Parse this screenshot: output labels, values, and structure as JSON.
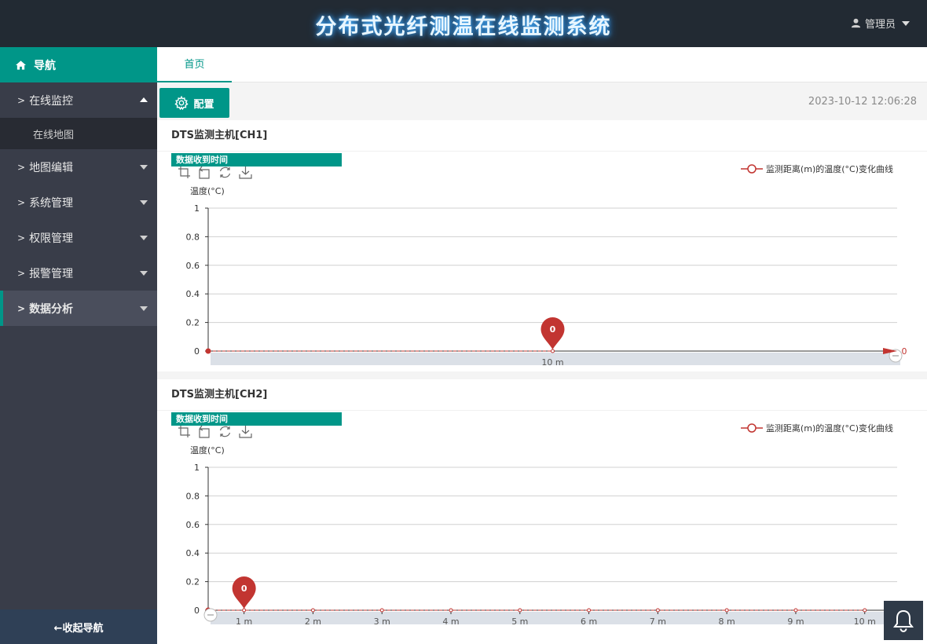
{
  "header": {
    "title": "分布式光纤测温在线监测系统",
    "user_label": "管理员"
  },
  "sidebar": {
    "nav_title": "导航",
    "items": [
      {
        "label": "在线监控",
        "state": "open",
        "sub": [
          "在线地图"
        ]
      },
      {
        "label": "地图编辑",
        "state": "collapsed"
      },
      {
        "label": "系统管理",
        "state": "collapsed"
      },
      {
        "label": "权限管理",
        "state": "collapsed"
      },
      {
        "label": "报警管理",
        "state": "collapsed"
      },
      {
        "label": "数据分析",
        "state": "active"
      }
    ],
    "collapse_label": "←收起导航"
  },
  "tabs": [
    {
      "label": "首页"
    }
  ],
  "toolbar": {
    "config_label": "配置",
    "datetime": "2023-10-12 12:06:28"
  },
  "panels": [
    {
      "title": "DTS监测主机[CH1]",
      "badge": "数据收到时间",
      "legend": "监测距离(m)的温度(°C)变化曲线",
      "ylabel": "温度(°C)",
      "yticks": [
        "1",
        "0.8",
        "0.6",
        "0.4",
        "0.2",
        "0"
      ],
      "xticks": [
        "10 m"
      ],
      "marker_value": "0",
      "end_value": "0"
    },
    {
      "title": "DTS监测主机[CH2]",
      "badge": "数据收到时间",
      "legend": "监测距离(m)的温度(°C)变化曲线",
      "ylabel": "温度(°C)",
      "yticks": [
        "1",
        "0.8",
        "0.6",
        "0.4",
        "0.2",
        "0"
      ],
      "xticks": [
        "1 m",
        "2 m",
        "3 m",
        "4 m",
        "5 m",
        "6 m",
        "7 m",
        "8 m",
        "9 m",
        "10 m"
      ],
      "marker_value": "0"
    }
  ],
  "chart_data": [
    {
      "type": "line",
      "title": "",
      "xlabel": "",
      "ylabel": "温度(°C)",
      "ylim": [
        0,
        1
      ],
      "x": [
        0,
        10
      ],
      "series": [
        {
          "name": "监测距离(m)的温度(°C)变化曲线",
          "values": [
            0,
            0
          ]
        }
      ],
      "markpoint": {
        "x": 10,
        "value": 0
      },
      "grid": true,
      "legend": "top-right"
    },
    {
      "type": "line",
      "title": "",
      "xlabel": "",
      "ylabel": "温度(°C)",
      "ylim": [
        0,
        1
      ],
      "x": [
        1,
        2,
        3,
        4,
        5,
        6,
        7,
        8,
        9,
        10
      ],
      "series": [
        {
          "name": "监测距离(m)的温度(°C)变化曲线",
          "values": [
            0,
            0,
            0,
            0,
            0,
            0,
            0,
            0,
            0,
            0
          ]
        }
      ],
      "markpoint": {
        "x": 1,
        "value": 0
      },
      "grid": true,
      "legend": "top-right"
    }
  ],
  "colors": {
    "accent": "#009688",
    "topbar": "#222a33",
    "sidebar": "#393d49",
    "series": "#c23531"
  }
}
